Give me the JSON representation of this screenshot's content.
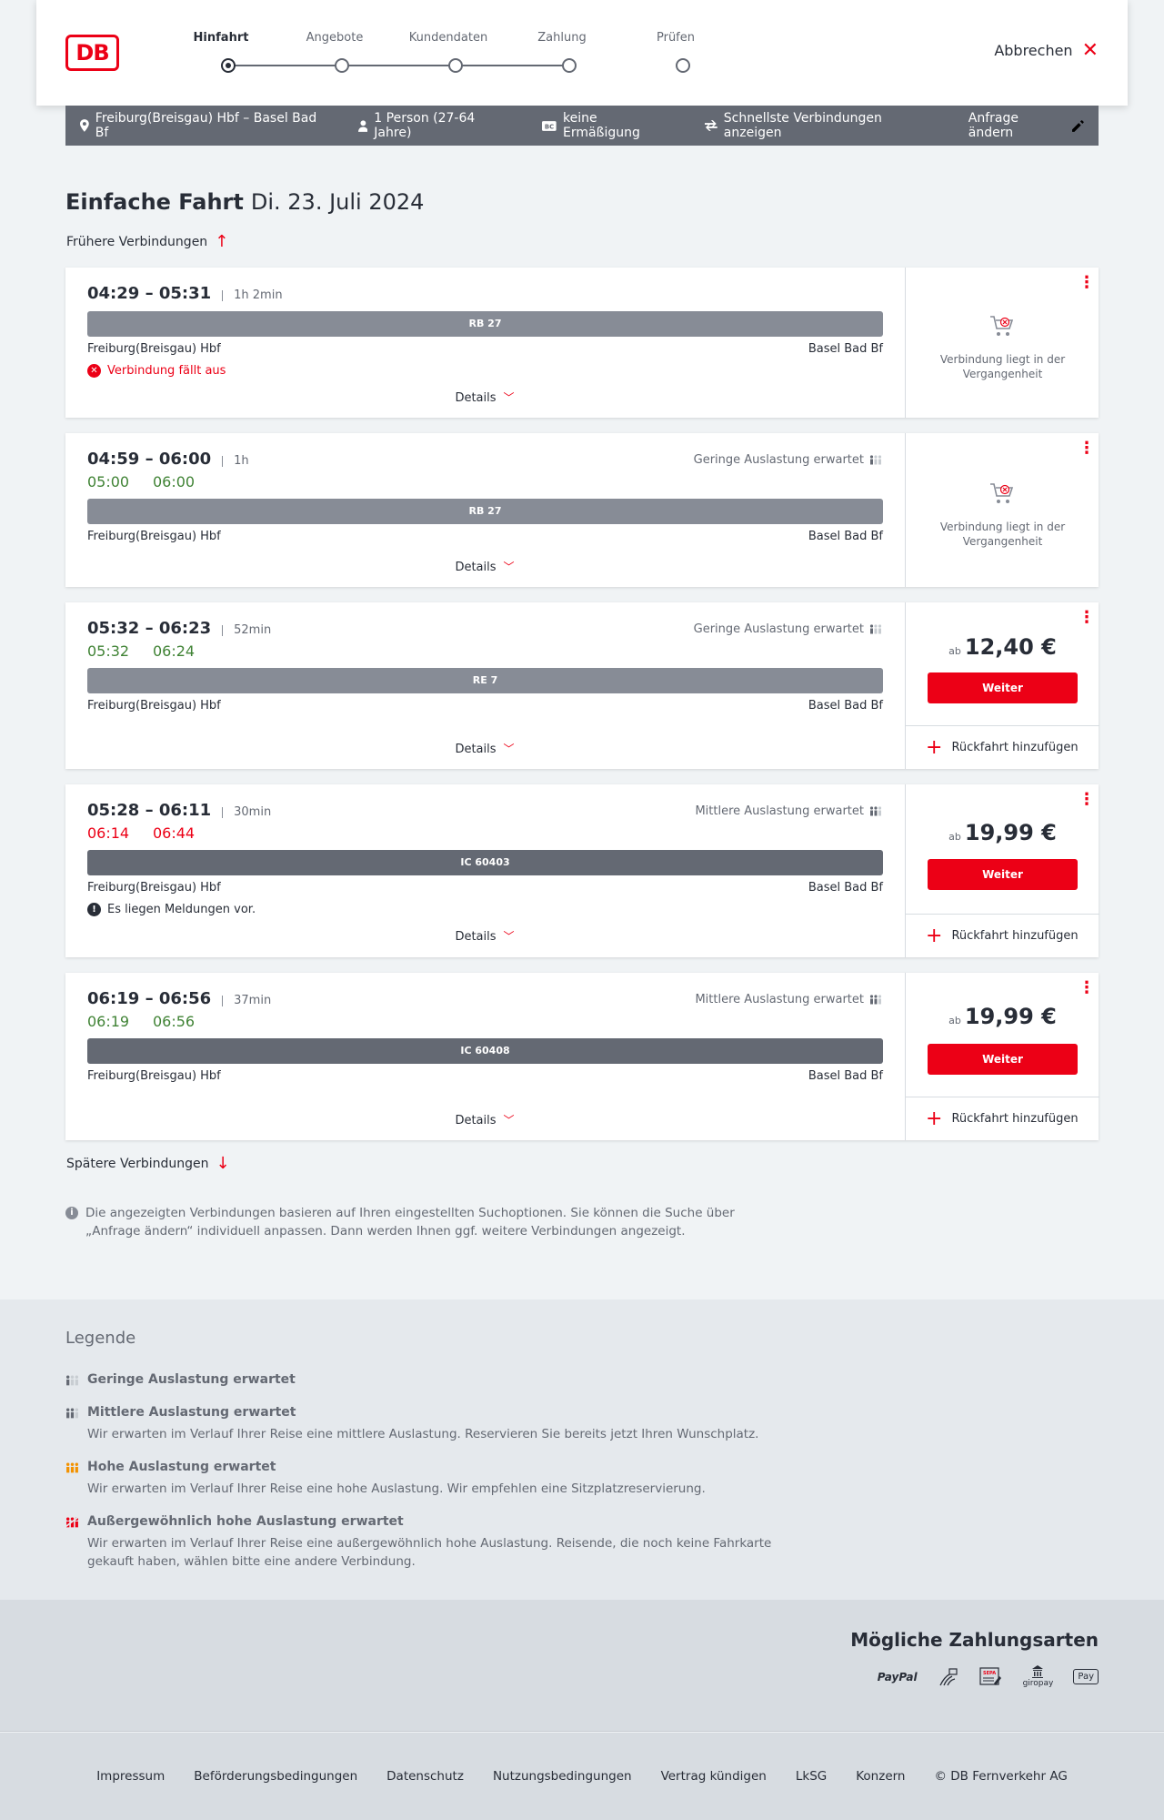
{
  "header": {
    "logo": "DB",
    "steps": [
      "Hinfahrt",
      "Angebote",
      "Kundendaten",
      "Zahlung",
      "Prüfen"
    ],
    "cancel_label": "Abbrechen"
  },
  "search": {
    "route": "Freiburg(Breisgau) Hbf – Basel Bad Bf",
    "passengers": "1 Person (27-64 Jahre)",
    "discount": "keine Ermäßigung",
    "fastest": "Schnellste Verbindungen anzeigen",
    "change_label": "Anfrage ändern"
  },
  "page": {
    "title": "Einfache Fahrt",
    "date": "Di. 23. Juli 2024",
    "earlier": "Frühere Verbindungen",
    "later": "Spätere Verbindungen"
  },
  "connections": [
    {
      "times": "04:29 – 05:31",
      "duration": "1h 2min",
      "train": "RB 27",
      "from": "Freiburg(Breisgau) Hbf",
      "to": "Basel Bad Bf",
      "note": "Verbindung fällt aus",
      "details": "Details",
      "past_text": "Verbindung liegt in der Vergangenheit"
    },
    {
      "times": "04:59 – 06:00",
      "duration": "1h",
      "rt_dep": "05:00",
      "rt_arr": "06:00",
      "load": "Geringe Auslastung erwartet",
      "train": "RB 27",
      "from": "Freiburg(Breisgau) Hbf",
      "to": "Basel Bad Bf",
      "details": "Details",
      "past_text": "Verbindung liegt in der Vergangenheit"
    },
    {
      "times": "05:32 – 06:23",
      "duration": "52min",
      "rt_dep": "05:32",
      "rt_arr": "06:24",
      "load": "Geringe Auslastung erwartet",
      "train": "RE 7",
      "from": "Freiburg(Breisgau) Hbf",
      "to": "Basel Bad Bf",
      "details": "Details",
      "price_prefix": "ab",
      "price": "12,40 €",
      "button": "Weiter",
      "return": "Rückfahrt hinzufügen"
    },
    {
      "times": "05:28 – 06:11",
      "duration": "30min",
      "rt_dep": "06:14",
      "rt_arr": "06:44",
      "load": "Mittlere Auslastung erwartet",
      "train": "IC 60403",
      "from": "Freiburg(Breisgau) Hbf",
      "to": "Basel Bad Bf",
      "note": "Es liegen Meldungen vor.",
      "details": "Details",
      "price_prefix": "ab",
      "price": "19,99 €",
      "button": "Weiter",
      "return": "Rückfahrt hinzufügen"
    },
    {
      "times": "06:19 – 06:56",
      "duration": "37min",
      "rt_dep": "06:19",
      "rt_arr": "06:56",
      "load": "Mittlere Auslastung erwartet",
      "train": "IC 60408",
      "from": "Freiburg(Breisgau) Hbf",
      "to": "Basel Bad Bf",
      "details": "Details",
      "price_prefix": "ab",
      "price": "19,99 €",
      "button": "Weiter",
      "return": "Rückfahrt hinzufügen"
    }
  ],
  "info": "Die angezeigten Verbindungen basieren auf Ihren eingestellten Suchoptionen. Sie können die Suche über „Anfrage ändern“ individuell anpassen. Dann werden Ihnen ggf. weitere Verbindungen angezeigt.",
  "legend": {
    "title": "Legende",
    "items": [
      {
        "title": "Geringe Auslastung erwartet",
        "desc": ""
      },
      {
        "title": "Mittlere Auslastung erwartet",
        "desc": "Wir erwarten im Verlauf Ihrer Reise eine mittlere Auslastung. Reservieren Sie bereits jetzt Ihren Wunschplatz."
      },
      {
        "title": "Hohe Auslastung erwartet",
        "desc": "Wir erwarten im Verlauf Ihrer Reise eine hohe Auslastung. Wir empfehlen eine Sitzplatzreservierung."
      },
      {
        "title": "Außergewöhnlich hohe Auslastung erwartet",
        "desc": "Wir erwarten im Verlauf Ihrer Reise eine außergewöhnlich hohe Auslastung. Reisende, die noch keine Fahrkarte gekauft haben, wählen bitte eine andere Verbindung."
      }
    ]
  },
  "payment": {
    "title": "Mögliche Zahlungsarten",
    "methods": [
      "PayPal",
      "SEPA",
      "giropay",
      "Pay"
    ]
  },
  "footer": [
    "Impressum",
    "Beförderungsbedingungen",
    "Datenschutz",
    "Nutzungsbedingungen",
    "Vertrag kündigen",
    "LkSG",
    "Konzern",
    "© DB Fernverkehr AG"
  ],
  "colors": {
    "brand_red": "#ec0016",
    "green": "#408335",
    "grey_bar": "#878c96",
    "dark_bar": "#646973"
  }
}
